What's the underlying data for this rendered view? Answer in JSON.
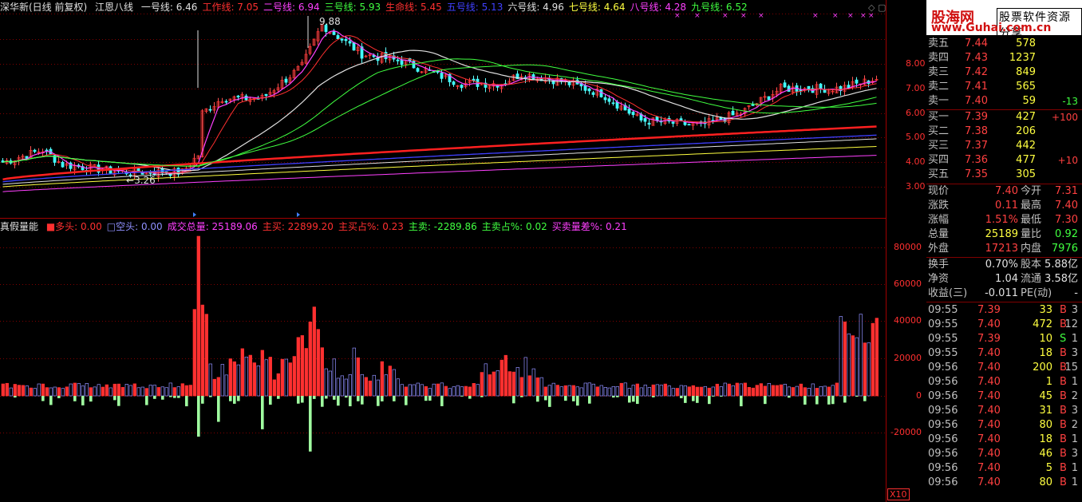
{
  "top_legend": {
    "stock": "深华新(日线 前复权)",
    "indicator": "江恩八线",
    "lines": [
      {
        "label": "一号线: 6.46",
        "color": "#e0e0e0"
      },
      {
        "label": "工作线: 7.05",
        "color": "#ff3030"
      },
      {
        "label": "二号线: 6.94",
        "color": "#ff40ff"
      },
      {
        "label": "三号线: 5.93",
        "color": "#40ff40"
      },
      {
        "label": "生命线: 5.45",
        "color": "#ff3030"
      },
      {
        "label": "五号线: 5.13",
        "color": "#4040ff"
      },
      {
        "label": "六号线: 4.96",
        "color": "#e0e0e0"
      },
      {
        "label": "七号线: 4.64",
        "color": "#ffff40"
      },
      {
        "label": "八号线: 4.28",
        "color": "#ff40ff"
      },
      {
        "label": "九号线: 6.52",
        "color": "#40ff40"
      }
    ]
  },
  "price_annotations": {
    "high": "9.88",
    "low": "3.26"
  },
  "price_axis": [
    "8.00",
    "7.00",
    "6.00",
    "5.00",
    "4.00",
    "3.00"
  ],
  "volume_legend": {
    "name": "真假量能",
    "items": [
      {
        "label": "■多头: 0.00",
        "color": "#ff3030"
      },
      {
        "label": "□空头: 0.00",
        "color": "#9090ff"
      },
      {
        "label": "成交总量: 25189.06",
        "color": "#ff40ff"
      },
      {
        "label": "主买: 22899.20",
        "color": "#ff3030"
      },
      {
        "label": "主买占%: 0.23",
        "color": "#ff3030"
      },
      {
        "label": "主卖: -2289.86",
        "color": "#40ff40"
      },
      {
        "label": "主卖占%: 0.02",
        "color": "#40ff40"
      },
      {
        "label": "买卖量差%: 0.21",
        "color": "#ff40ff"
      }
    ]
  },
  "volume_axis": [
    "80000",
    "60000",
    "40000",
    "20000",
    "0",
    "-20000"
  ],
  "zoom_label": "X10",
  "brand": {
    "logo": "股海网",
    "tagline": "股票软件资源分享",
    "url": "www.Guhai.com.cn"
  },
  "order_book": {
    "sell": [
      {
        "label": "卖五",
        "price": "7.44",
        "vol": "578",
        "chg": ""
      },
      {
        "label": "卖四",
        "price": "7.43",
        "vol": "1237",
        "chg": ""
      },
      {
        "label": "卖三",
        "price": "7.42",
        "vol": "849",
        "chg": ""
      },
      {
        "label": "卖二",
        "price": "7.41",
        "vol": "565",
        "chg": ""
      },
      {
        "label": "卖一",
        "price": "7.40",
        "vol": "59",
        "chg": "-13"
      }
    ],
    "buy": [
      {
        "label": "买一",
        "price": "7.39",
        "vol": "427",
        "chg": "+100"
      },
      {
        "label": "买二",
        "price": "7.38",
        "vol": "206",
        "chg": ""
      },
      {
        "label": "买三",
        "price": "7.37",
        "vol": "442",
        "chg": ""
      },
      {
        "label": "买四",
        "price": "7.36",
        "vol": "477",
        "chg": "+10"
      },
      {
        "label": "买五",
        "price": "7.35",
        "vol": "305",
        "chg": ""
      }
    ]
  },
  "quote": [
    {
      "l1": "现价",
      "v1": "7.40",
      "c1": "red",
      "l2": "今开",
      "v2": "7.31",
      "c2": "red"
    },
    {
      "l1": "涨跌",
      "v1": "0.11",
      "c1": "red",
      "l2": "最高",
      "v2": "7.40",
      "c2": "red"
    },
    {
      "l1": "涨幅",
      "v1": "1.51%",
      "c1": "red",
      "l2": "最低",
      "v2": "7.30",
      "c2": "red"
    },
    {
      "l1": "总量",
      "v1": "25189",
      "c1": "yellow",
      "l2": "量比",
      "v2": "0.92",
      "c2": "green"
    },
    {
      "l1": "外盘",
      "v1": "17213",
      "c1": "red",
      "l2": "内盘",
      "v2": "7976",
      "c2": "green"
    }
  ],
  "fundamentals": [
    {
      "l1": "换手",
      "v1": "0.70%",
      "c1": "white",
      "l2": "股本",
      "v2": "5.88亿",
      "c2": "white"
    },
    {
      "l1": "净资",
      "v1": "1.04",
      "c1": "white",
      "l2": "流通",
      "v2": "3.58亿",
      "c2": "white"
    },
    {
      "l1": "收益(三)",
      "v1": "-0.011",
      "c1": "white",
      "l2": "PE(动)",
      "v2": "-",
      "c2": "white"
    }
  ],
  "ticks": [
    {
      "time": "09:55",
      "price": "7.39",
      "vol": "33",
      "dir": "B",
      "n": "3"
    },
    {
      "time": "09:55",
      "price": "7.40",
      "vol": "472",
      "dir": "B",
      "n": "12"
    },
    {
      "time": "09:55",
      "price": "7.39",
      "vol": "10",
      "dir": "S",
      "n": "1"
    },
    {
      "time": "09:55",
      "price": "7.40",
      "vol": "18",
      "dir": "B",
      "n": "3"
    },
    {
      "time": "09:56",
      "price": "7.40",
      "vol": "200",
      "dir": "B",
      "n": "15"
    },
    {
      "time": "09:56",
      "price": "7.40",
      "vol": "1",
      "dir": "B",
      "n": "1"
    },
    {
      "time": "09:56",
      "price": "7.40",
      "vol": "45",
      "dir": "B",
      "n": "2"
    },
    {
      "time": "09:56",
      "price": "7.40",
      "vol": "31",
      "dir": "B",
      "n": "3"
    },
    {
      "time": "09:56",
      "price": "7.40",
      "vol": "80",
      "dir": "B",
      "n": "2"
    },
    {
      "time": "09:56",
      "price": "7.40",
      "vol": "18",
      "dir": "B",
      "n": "1"
    },
    {
      "time": "09:56",
      "price": "7.40",
      "vol": "46",
      "dir": "B",
      "n": "3"
    },
    {
      "time": "09:56",
      "price": "7.40",
      "vol": "5",
      "dir": "B",
      "n": "1"
    },
    {
      "time": "09:56",
      "price": "7.40",
      "vol": "80",
      "dir": "B",
      "n": "1"
    }
  ],
  "colors": {
    "up": "#ff3030",
    "down": "#40ff40",
    "grid": "#800000",
    "bg": "#000000"
  }
}
